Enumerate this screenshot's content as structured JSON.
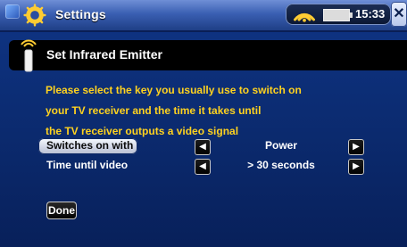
{
  "window": {
    "title": "Settings",
    "time": "15:33",
    "close_label": "✕",
    "colors": {
      "accent": "#ffd21f",
      "background": "#0f3586"
    },
    "icons": {
      "app": "app-icon",
      "settings": "gear-icon",
      "signal": "signal-icon",
      "battery": "battery-icon"
    }
  },
  "dialog": {
    "title": "Set Infrared Emitter",
    "instruction_lines": [
      "Please select the key you usually use to switch on",
      "your TV receiver and the time it takes until",
      "the TV receiver outputs a video signal"
    ],
    "rows": [
      {
        "label": "Switches on with",
        "value": "Power"
      },
      {
        "label": "Time until video",
        "value": "> 30 seconds"
      }
    ],
    "arrows": {
      "left": "◀",
      "right": "▶"
    },
    "done_label": "Done"
  }
}
